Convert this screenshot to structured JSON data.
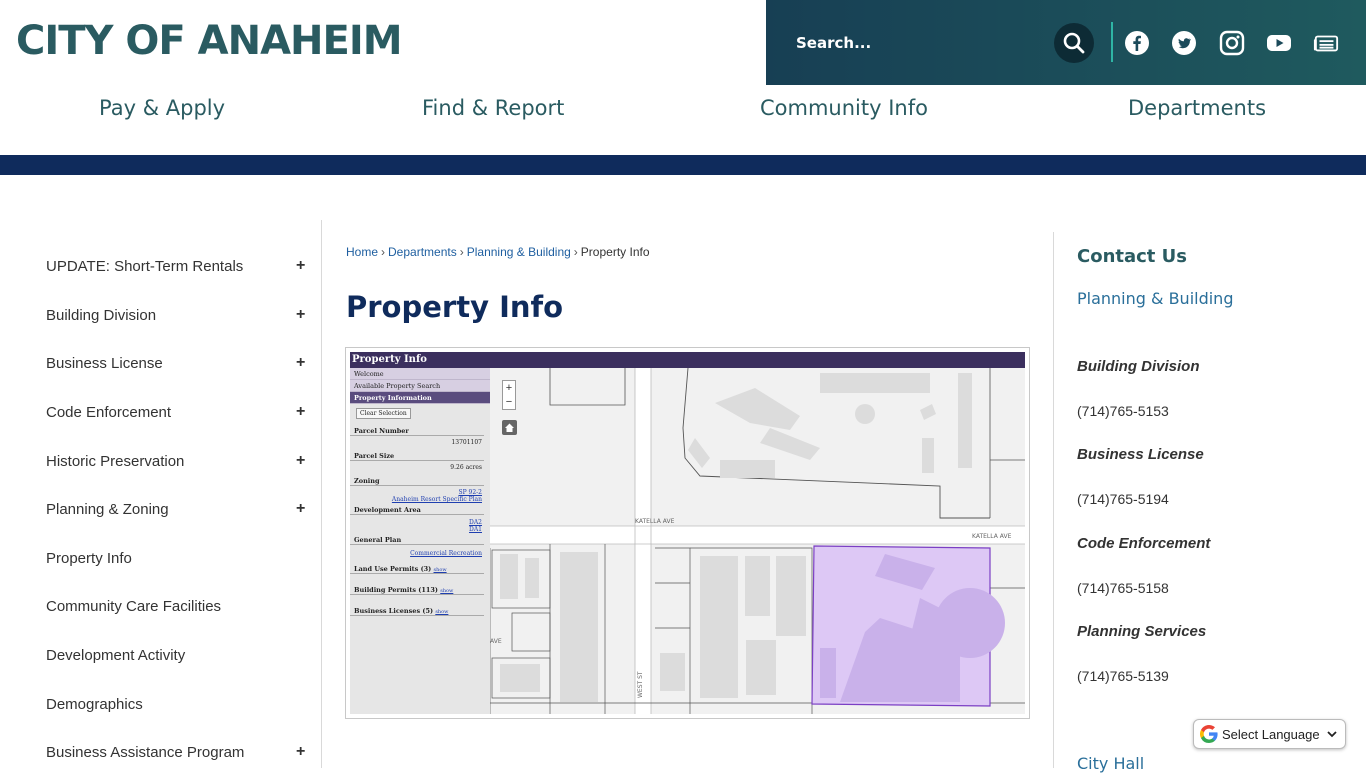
{
  "header": {
    "logo": "CITY OF ANAHEIM",
    "search_placeholder": "Search...",
    "social": [
      "facebook-icon",
      "twitter-icon",
      "instagram-icon",
      "youtube-icon",
      "news-icon"
    ]
  },
  "nav": {
    "items": [
      "Pay & Apply",
      "Find & Report",
      "Community Info",
      "Departments"
    ]
  },
  "sidebar": {
    "items": [
      {
        "label": "UPDATE: Short-Term Rentals",
        "expandable": true
      },
      {
        "label": "Building Division",
        "expandable": true
      },
      {
        "label": "Business License",
        "expandable": true
      },
      {
        "label": "Code Enforcement",
        "expandable": true
      },
      {
        "label": "Historic Preservation",
        "expandable": true
      },
      {
        "label": "Planning & Zoning",
        "expandable": true
      },
      {
        "label": "Property Info",
        "expandable": false
      },
      {
        "label": "Community Care Facilities",
        "expandable": false
      },
      {
        "label": "Development Activity",
        "expandable": false
      },
      {
        "label": "Demographics",
        "expandable": false
      },
      {
        "label": "Business Assistance Program",
        "expandable": true
      }
    ],
    "plus_symbol": "+"
  },
  "breadcrumb": {
    "items": [
      "Home",
      "Departments",
      "Planning & Building",
      "Property Info"
    ],
    "separator": "›"
  },
  "page": {
    "title": "Property Info"
  },
  "map_screenshot": {
    "title": "Property Info",
    "tabs": [
      "Welcome",
      "Available Property Search",
      "Property Information"
    ],
    "clear_button": "Clear Selection",
    "parcel_number_label": "Parcel Number",
    "parcel_number": "13701107",
    "parcel_size_label": "Parcel Size",
    "parcel_size": "9.26 acres",
    "zoning_label": "Zoning",
    "zoning_links": [
      "SP 92-2",
      "Anaheim Resort Specific Plan"
    ],
    "dev_area_label": "Development Area",
    "dev_area_links": [
      "DA2",
      "DA1"
    ],
    "general_plan_label": "General Plan",
    "general_plan_link": "Commercial Recreation",
    "land_use_label": "Land Use Permits (3)",
    "building_permits_label": "Building Permits (113)",
    "business_licenses_label": "Business Licenses (5)",
    "show_link": "show",
    "street_katella": "KATELLA AVE",
    "street_west": "WEST ST",
    "street_ave": "AVE",
    "zoom_in": "+",
    "zoom_out": "−"
  },
  "contact": {
    "title": "Contact Us",
    "department": "Planning & Building",
    "entries": [
      {
        "label": "Building Division",
        "phone": "(714)765-5153"
      },
      {
        "label": "Business License",
        "phone": "(714)765-5194"
      },
      {
        "label": "Code Enforcement",
        "phone": "(714)765-5158"
      },
      {
        "label": "Planning Services",
        "phone": "(714)765-5139"
      }
    ],
    "city_hall": "City Hall"
  },
  "translate": {
    "label": "Select Language"
  },
  "colors": {
    "brand_teal": "#2a5b61",
    "navy": "#0f2b5c",
    "link_blue": "#1f5fa0",
    "parcel_fill": "#d9c6f2",
    "parcel_stroke": "#7b3fc4"
  }
}
